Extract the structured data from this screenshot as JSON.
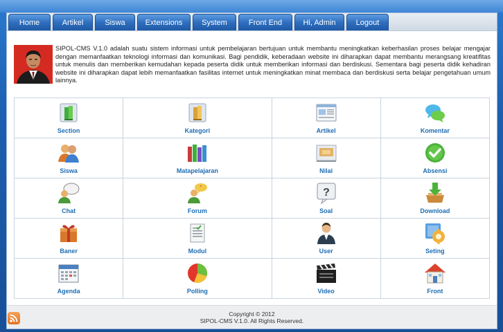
{
  "nav": {
    "items": [
      {
        "label": "Home",
        "id": "home"
      },
      {
        "label": "Artikel",
        "id": "artikel"
      },
      {
        "label": "Siswa",
        "id": "siswa"
      },
      {
        "label": "Extensions",
        "id": "extensions"
      },
      {
        "label": "System",
        "id": "system"
      },
      {
        "label": "Front End",
        "id": "front-end"
      },
      {
        "label": "Hi, Admin",
        "id": "hi-admin"
      },
      {
        "label": "Logout",
        "id": "logout"
      }
    ]
  },
  "intro": {
    "text": "SIPOL-CMS V.1.0 adalah suatu sistem informasi untuk pembelajaran bertujuan untuk membantu meningkatkan keberhasilan proses belajar mengajar dengan memanfaatkan teknologi informasi dan komunikasi. Bagi pendidik, keberadaan website ini diharapkan dapat membantu merangsang kreatifitas untuk menulis dan memberikan kemudahan kepada peserta didik untuk memberikan informasi dan berdiskusi. Sementara bagi peserta didik kehadiran website ini diharapkan dapat lebih memanfaatkan fasilitas internet untuk meningkatkan minat membaca dan berdiskusi serta belajar pengetahuan umum lainnya."
  },
  "grid": {
    "rows": [
      [
        {
          "label": "Section",
          "icon": "section-icon"
        },
        {
          "label": "Kategori",
          "icon": "kategori-icon"
        },
        {
          "label": "Artikel",
          "icon": "artikel-icon"
        },
        {
          "label": "Komentar",
          "icon": "komentar-icon"
        }
      ],
      [
        {
          "label": "Siswa",
          "icon": "siswa-icon"
        },
        {
          "label": "Matapelajaran",
          "icon": "matapelajaran-icon"
        },
        {
          "label": "Nilai",
          "icon": "nilai-icon"
        },
        {
          "label": "Absensi",
          "icon": "absensi-icon"
        }
      ],
      [
        {
          "label": "Chat",
          "icon": "chat-icon"
        },
        {
          "label": "Forum",
          "icon": "forum-icon"
        },
        {
          "label": "Soal",
          "icon": "soal-icon"
        },
        {
          "label": "Download",
          "icon": "download-icon"
        }
      ],
      [
        {
          "label": "Baner",
          "icon": "baner-icon"
        },
        {
          "label": "Modul",
          "icon": "modul-icon"
        },
        {
          "label": "User",
          "icon": "user-icon"
        },
        {
          "label": "Seting",
          "icon": "seting-icon"
        }
      ],
      [
        {
          "label": "Agenda",
          "icon": "agenda-icon"
        },
        {
          "label": "Polling",
          "icon": "polling-icon"
        },
        {
          "label": "Video",
          "icon": "video-icon"
        },
        {
          "label": "Front",
          "icon": "front-icon"
        }
      ]
    ]
  },
  "footer": {
    "line1": "Copyright © 2012",
    "line2": "SIPOL-CMS V.1.0. All Rights Reserved."
  }
}
